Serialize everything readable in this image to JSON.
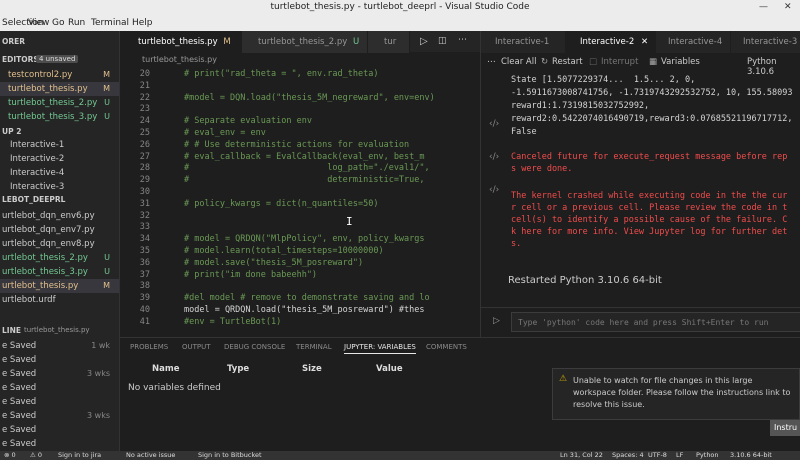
{
  "window": {
    "title": "turtlebot_thesis.py - turtlebot_deeprl - Visual Studio Code",
    "minimize_icon": "minimize-icon",
    "close_icon": "close-icon"
  },
  "menu": [
    "Selection",
    "View",
    "Go",
    "Run",
    "Terminal",
    "Help"
  ],
  "sidebar": {
    "open_editors_header": "ORER",
    "editors_header": "EDITORS",
    "unsaved_badge": "4 unsaved",
    "open_files": [
      {
        "name": "testcontrol2.py",
        "status": "M"
      },
      {
        "name": "turtlebot_thesis.py",
        "status": "M"
      },
      {
        "name": "turtlebot_thesis_2.py",
        "status": "U"
      },
      {
        "name": "turtlebot_thesis_3.py",
        "status": "U"
      }
    ],
    "group_header": "UP 2",
    "interactives": [
      "Interactive-1",
      "Interactive-2",
      "Interactive-4",
      "Interactive-3"
    ],
    "project_header": "LEBOT_DEEPRL",
    "project_files": [
      {
        "name": "urtlebot_dqn_env6.py",
        "status": ""
      },
      {
        "name": "urtlebot_dqn_env7.py",
        "status": ""
      },
      {
        "name": "urtlebot_dqn_env8.py",
        "status": ""
      },
      {
        "name": "urtlebot_thesis_2.py",
        "status": "U"
      },
      {
        "name": "urtlebot_thesis_3.py",
        "status": "U"
      },
      {
        "name": "urtlebot_thesis.py",
        "status": "M"
      },
      {
        "name": "urtlebot.urdf",
        "status": ""
      }
    ],
    "timeline_header": "LINE",
    "timeline_file": "turtlebot_thesis.py",
    "timeline_items": [
      {
        "label": "e Saved",
        "when": "1 wk"
      },
      {
        "label": "e Saved",
        "when": ""
      },
      {
        "label": "e Saved",
        "when": "3 wks"
      },
      {
        "label": "e Saved",
        "when": ""
      },
      {
        "label": "e Saved",
        "when": ""
      },
      {
        "label": "e Saved",
        "when": "3 wks"
      },
      {
        "label": "e Saved",
        "when": ""
      },
      {
        "label": "e Saved",
        "when": ""
      }
    ]
  },
  "editor": {
    "tabs": [
      {
        "label": "turtlebot_thesis.py",
        "status": "M"
      },
      {
        "label": "turtlebot_thesis_2.py",
        "status": "U"
      },
      {
        "label": "tur",
        "status": ""
      }
    ],
    "breadcrumb": "turtlebot_thesis.py",
    "lines": [
      {
        "n": "20",
        "text": "# print(\"rad_theta = \", env.rad_theta)",
        "cls": "comment"
      },
      {
        "n": "21",
        "text": "",
        "cls": "plain"
      },
      {
        "n": "22",
        "text": "#model = DQN.load(\"thesis_5M_negreward\", env=env)",
        "cls": "comment"
      },
      {
        "n": "23",
        "text": "",
        "cls": "plain"
      },
      {
        "n": "24",
        "text": "# Separate evaluation env",
        "cls": "comment"
      },
      {
        "n": "25",
        "text": "# eval_env = env",
        "cls": "comment"
      },
      {
        "n": "26",
        "text": "# # Use deterministic actions for evaluation",
        "cls": "comment"
      },
      {
        "n": "27",
        "text": "# eval_callback = EvalCallback(eval_env, best_m",
        "cls": "comment"
      },
      {
        "n": "28",
        "text": "#                           log_path=\"./eval1/\",",
        "cls": "comment"
      },
      {
        "n": "29",
        "text": "#                           deterministic=True,",
        "cls": "comment"
      },
      {
        "n": "30",
        "text": "",
        "cls": "plain"
      },
      {
        "n": "31",
        "text": "# policy_kwargs = dict(n_quantiles=50)",
        "cls": "comment"
      },
      {
        "n": "32",
        "text": "",
        "cls": "plain"
      },
      {
        "n": "33",
        "text": "",
        "cls": "plain"
      },
      {
        "n": "34",
        "text": "# model = QRDQN(\"MlpPolicy\", env, policy_kwargs",
        "cls": "comment"
      },
      {
        "n": "35",
        "text": "# model.learn(total_timesteps=10000000)",
        "cls": "comment"
      },
      {
        "n": "36",
        "text": "# model.save(\"thesis_5M_posreward\")",
        "cls": "comment"
      },
      {
        "n": "37",
        "text": "# print(\"im done babeehh\")",
        "cls": "comment"
      },
      {
        "n": "38",
        "text": "",
        "cls": "plain"
      },
      {
        "n": "39",
        "text": "#del model # remove to demonstrate saving and lo",
        "cls": "comment"
      },
      {
        "n": "40",
        "text": "model = QRDQN.load(\"thesis_5M_posreward\") #thes",
        "cls": "code40"
      },
      {
        "n": "41",
        "text": "#env = TurtleBot(1)",
        "cls": "comment"
      }
    ]
  },
  "interactive": {
    "tabs": [
      "Interactive-1",
      "Interactive-2",
      "Interactive-4",
      "Interactive-3"
    ],
    "toolbar": {
      "clear_all": "Clear All",
      "restart": "Restart",
      "interrupt": "Interrupt",
      "variables": "Variables",
      "kernel": "Python 3.10.6"
    },
    "output_lines": [
      "State [1.5077229374...  1.5... 2, 0,",
      "-1.5911673008741756, -1.7319743292532752, 10, 155.58093",
      "reward1:1.7319815032752992,",
      "reward2:0.5422074016490719,reward3:0.07685521196717712,",
      "False"
    ],
    "error_lines": [
      "Canceled future for execute_request message before rep",
      "s were done.",
      "",
      "The kernel crashed while executing code in the the cur",
      "r cell or a previous cell. Please review the code in t",
      "cell(s) to identify a possible cause of the failure. C",
      "k here for more info. View Jupyter log for further det",
      "s."
    ],
    "restarted": "Restarted Python 3.10.6 64-bit",
    "input_placeholder": "Type 'python' code here and press Shift+Enter to run"
  },
  "panel": {
    "tabs": [
      "PROBLEMS",
      "OUTPUT",
      "DEBUG CONSOLE",
      "TERMINAL",
      "JUPYTER: VARIABLES",
      "COMMENTS"
    ],
    "active_tab": "JUPYTER: VARIABLES",
    "columns": [
      "Name",
      "Type",
      "Size",
      "Value"
    ],
    "empty_message": "No variables defined"
  },
  "notification": {
    "message": "Unable to watch for file changes in this large workspace folder. Please follow the instructions link to resolve this issue.",
    "button": "Instru"
  },
  "statusbar": {
    "left": [
      "⊗ 0",
      "⚠ 0",
      "Sign in to jira",
      "No active issue",
      "Sign in to Bitbucket"
    ],
    "right": [
      "Ln 31, Col 22",
      "Spaces: 4",
      "UTF-8",
      "LF",
      "Python",
      "3.10.6 64-bit"
    ]
  },
  "colors": {
    "accent_green": "#73c991",
    "accent_yellow": "#e2c08d",
    "error": "#f14c4c",
    "link": "#3794ff"
  }
}
